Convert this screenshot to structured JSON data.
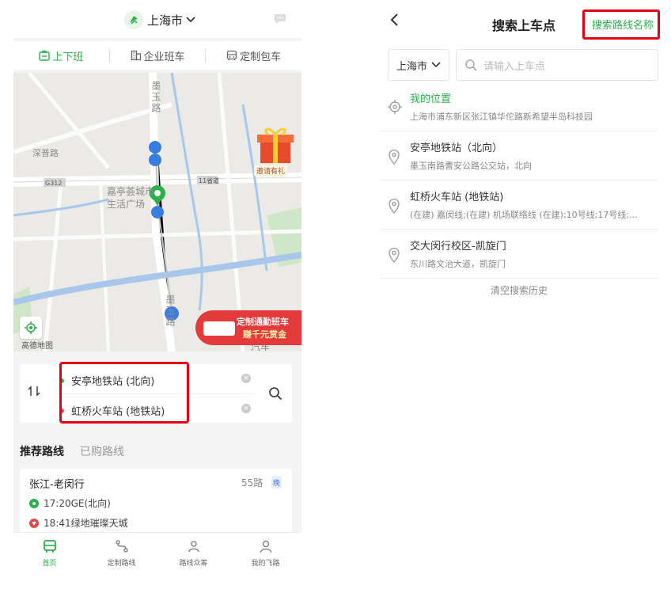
{
  "left": {
    "city": "上海市",
    "mode_tabs": [
      {
        "label": "上下班",
        "active": true
      },
      {
        "label": "企业班车",
        "active": false
      },
      {
        "label": "定制包车",
        "active": false
      }
    ],
    "map": {
      "road_labels": [
        "墨玉路",
        "墨玉路"
      ],
      "poi_labels": [
        "嘉亭荟城市生活广场",
        "汽车"
      ],
      "street_labels": [
        "深普路",
        "G312",
        "11省道"
      ],
      "gift_label": "邀请有礼",
      "source": "高德地图",
      "banner_line1": "定制通勤班车",
      "banner_line2": "赚千元赏金"
    },
    "route": {
      "from": "安亭地铁站 (北向)",
      "to": "虹桥火车站 (地铁站)"
    },
    "route_tabs": [
      {
        "label": "推荐路线",
        "active": true
      },
      {
        "label": "已购路线",
        "active": false
      }
    ],
    "line": {
      "name": "张江-老闵行",
      "number": "55路",
      "tag": "晚",
      "depart": "17:20GE(北向)",
      "arrive": "18:41绿地璀璨天城"
    },
    "nav": [
      {
        "label": "首页",
        "active": true
      },
      {
        "label": "定制路线",
        "active": false
      },
      {
        "label": "路线众筹",
        "active": false
      },
      {
        "label": "我的飞路",
        "active": false
      }
    ],
    "colors": {
      "brand": "#2ab14a",
      "highlight": "#e60012"
    }
  },
  "right": {
    "title": "搜索上车点",
    "link": "搜索路线名称",
    "city": "上海市",
    "search_placeholder": "请输入上车点",
    "items": [
      {
        "name": "我的位置",
        "addr": "上海市浦东新区张江镇华佗路新希望半岛科技园",
        "icon": "crosshair-icon"
      },
      {
        "name": "安亭地铁站（北向）",
        "addr": "墨玉南路曹安公路公交站，北向",
        "icon": "pin-icon"
      },
      {
        "name": "虹桥火车站 (地铁站)",
        "addr": "(在建) 嘉闵线;(在建) 机场联络线 (在建);10号线;17号线;...",
        "icon": "pin-icon"
      },
      {
        "name": "交大闵行校区-凯旋门",
        "addr": "东川路文治大道，凯旋门",
        "icon": "pin-icon"
      }
    ],
    "clear_history": "清空搜索历史"
  }
}
